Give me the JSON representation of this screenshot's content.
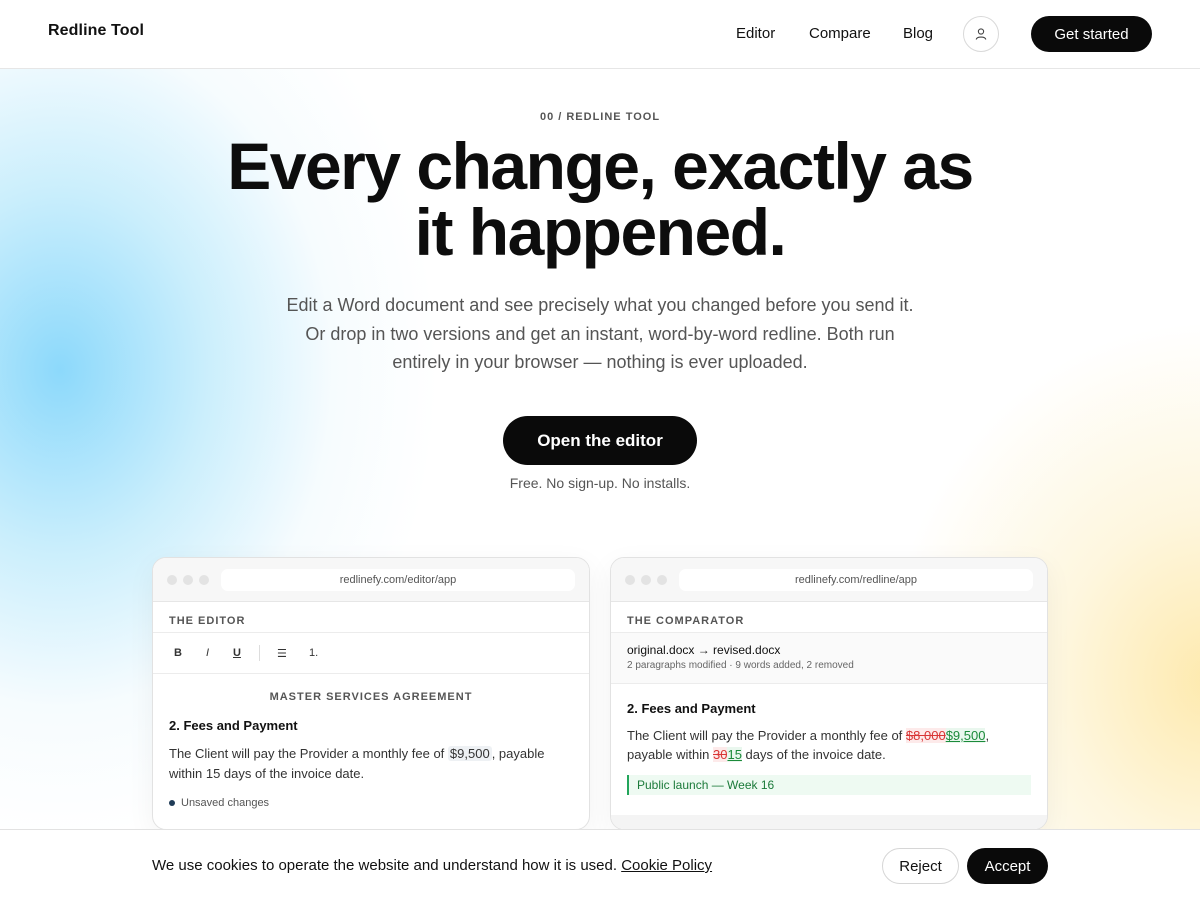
{
  "header": {
    "logo": "Redline Tool",
    "nav": [
      "Editor",
      "Compare",
      "Blog"
    ],
    "account_icon": "user-icon",
    "cta": "Get started"
  },
  "hero": {
    "eyebrow": "00 / REDLINE TOOL",
    "title_line1": "Every change, exactly as",
    "title_line2": "it happened.",
    "subtitle_line1": "Edit a Word document and see precisely what you changed before you send it.",
    "subtitle_line2": "Or drop in two versions and get an instant, word-by-word redline. Both run",
    "subtitle_line3": "entirely in your browser — nothing is ever uploaded.",
    "button": "Open the editor",
    "note": "Free. No sign-up. No installs."
  },
  "editor_card": {
    "url": "redlinefy.com/editor/app",
    "label": "THE EDITOR",
    "toolbar": [
      "B",
      "I",
      "U",
      "☰",
      "1."
    ],
    "doc_title": "MASTER SERVICES AGREEMENT",
    "section": "2. Fees and Payment",
    "para_before": "The Client will pay the Provider a monthly fee of ",
    "para_highlight": "$9,500",
    "para_after1": ", payable",
    "para_line2": "within 15 days of the invoice date.",
    "status": "Unsaved changes"
  },
  "compare_card": {
    "url": "redlinefy.com/redline/app",
    "label": "THE COMPARATOR",
    "files": "original.docx → revised.docx",
    "stats": "2 paragraphs modified · 9 words added, 2 removed",
    "section": "2. Fees and Payment",
    "p1": "The Client will pay the Provider a monthly fee of ",
    "del1": "$8,000",
    "ins1": "$9,500",
    "p2": ",",
    "p3": "payable within ",
    "del2": "30",
    "ins2": "15",
    "p4": " days of the invoice date.",
    "added": "Public launch — Week 16"
  },
  "cookie": {
    "text": "We use cookies to operate the website and understand how it is used. ",
    "link": "Cookie Policy",
    "reject": "Reject",
    "accept": "Accept"
  },
  "colors": {
    "primary": "#0a0a0a",
    "deleted": "#d93636",
    "inserted": "#1b8a3a",
    "glow_blue": "#78d2fa",
    "glow_yellow": "#fde6a0"
  }
}
